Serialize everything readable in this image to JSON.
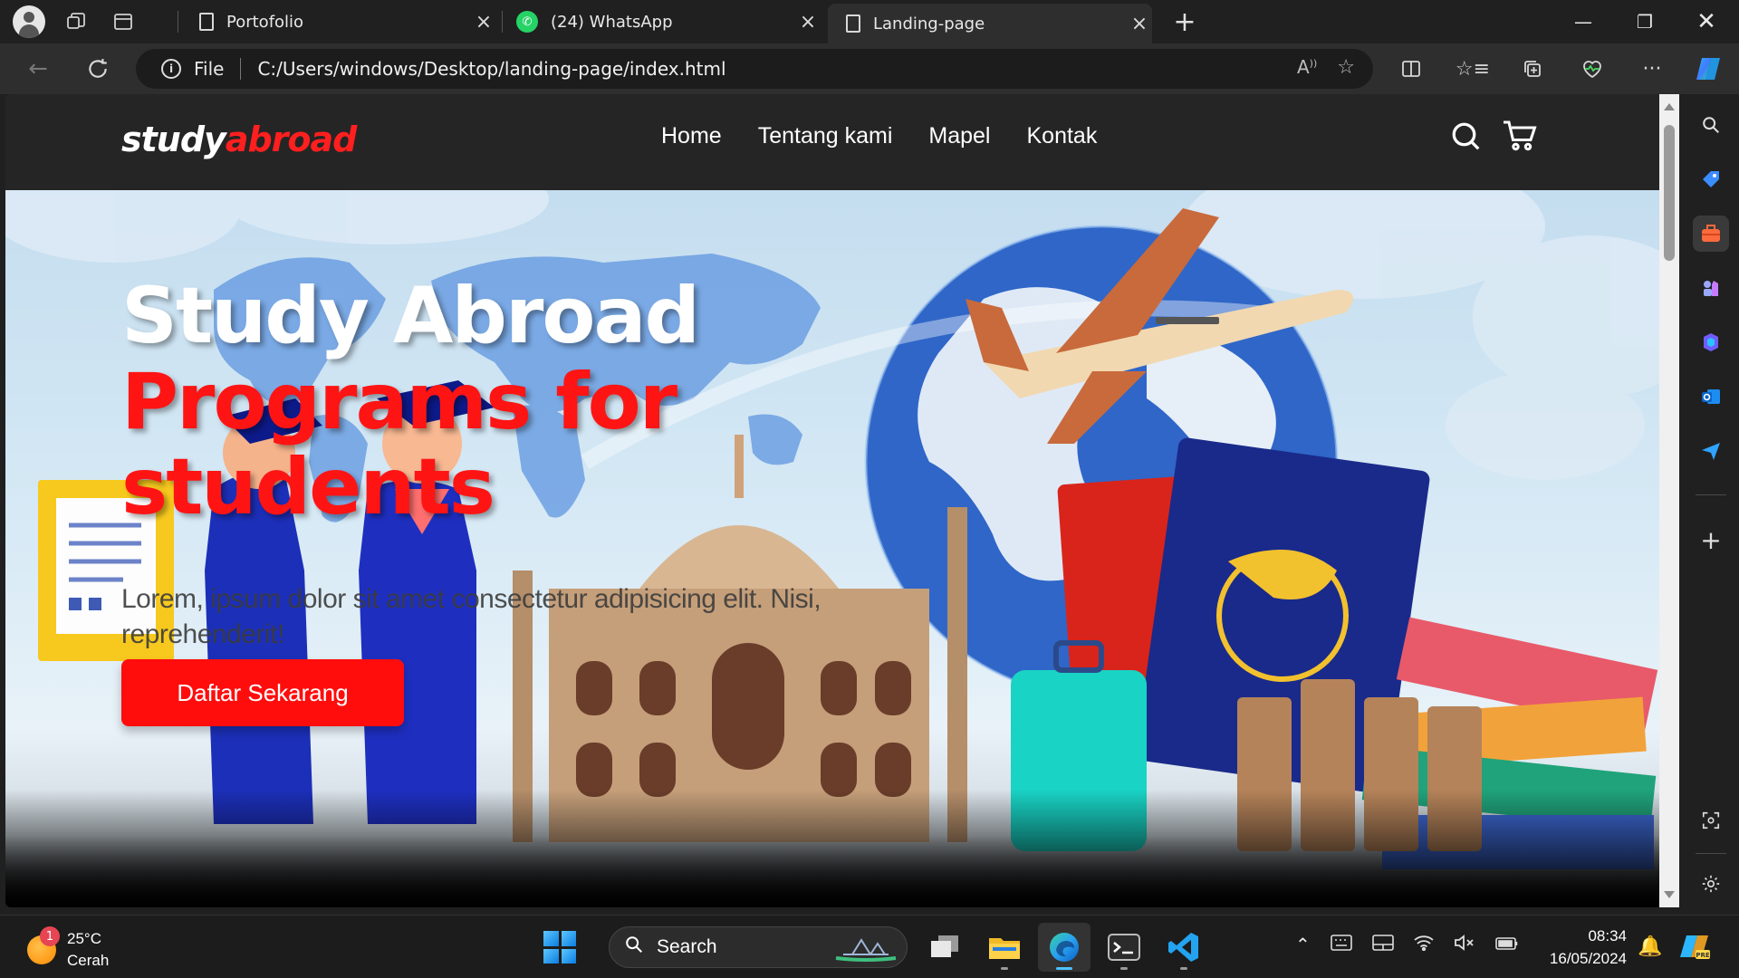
{
  "browser": {
    "tabs": [
      {
        "label": "Portofolio",
        "icon": "page-icon",
        "active": false
      },
      {
        "label": "(24) WhatsApp",
        "icon": "whatsapp-icon",
        "active": false
      },
      {
        "label": "Landing-page",
        "icon": "page-icon",
        "active": true
      }
    ],
    "address": {
      "scheme_label": "File",
      "url": "C:/Users/windows/Desktop/landing-page/index.html"
    }
  },
  "site": {
    "logo": {
      "part1": "study",
      "part2": "abroad"
    },
    "menu": [
      "Home",
      "Tentang kami",
      "Mapel",
      "Kontak"
    ],
    "hero": {
      "title_line1": "Study Abroad",
      "title_line2": "Programs for",
      "title_line3": "students",
      "description": "Lorem, ipsum dolor sit amet consectetur adipisicing elit. Nisi, reprehenderit!",
      "cta_label": "Daftar Sekarang"
    },
    "colors": {
      "accent": "#ff1414",
      "nav_bg": "#252525"
    }
  },
  "taskbar": {
    "weather": {
      "temp": "25°C",
      "condition": "Cerah",
      "badge": "1"
    },
    "search_placeholder": "Search",
    "clock": {
      "time": "08:34",
      "date": "16/05/2024"
    }
  }
}
